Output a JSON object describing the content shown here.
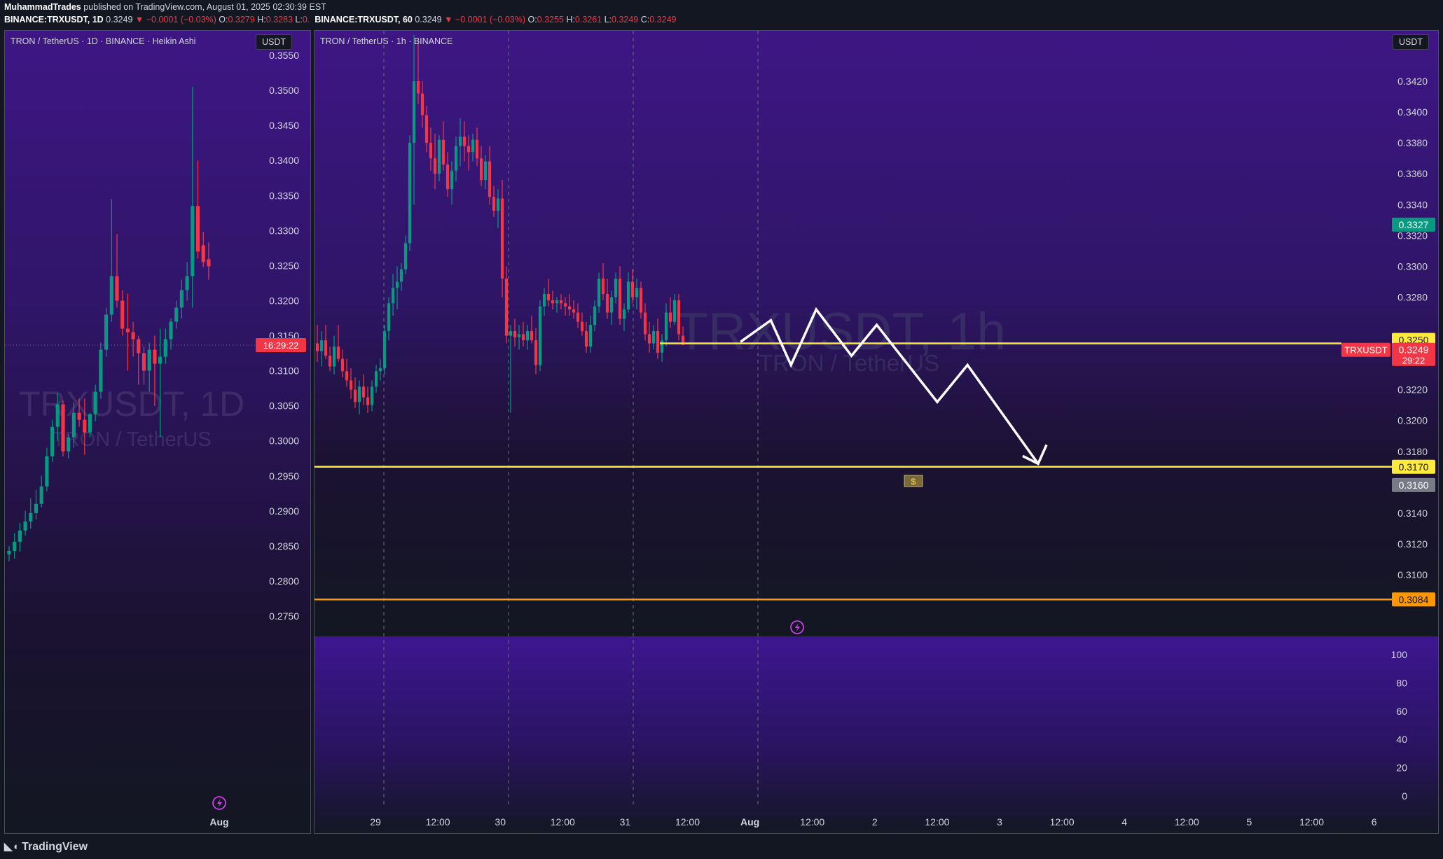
{
  "header": {
    "author": "MuhammadTrades",
    "published": "published on TradingView.com, August 01, 2025 02:30:39 EST",
    "left_ticker": "BINANCE:TRXUSDT, 1D",
    "left_price": "0.3249",
    "left_change": "−0.0001 (−0.03%)",
    "left_o": "0.3279",
    "left_h": "0.3283",
    "left_l": "0.",
    "right_ticker": "BINANCE:TRXUSDT, 60",
    "right_price": "0.3249",
    "right_change": "−0.0001 (−0.03%)",
    "right_o": "0.3255",
    "right_h": "0.3261",
    "right_l": "0.3249",
    "right_c": "0.3249"
  },
  "footer": {
    "brand": "TradingView"
  },
  "left_panel": {
    "title": "TRON / TetherUS · 1D · BINANCE · Heikin Ashi",
    "currency": "USDT",
    "watermark_symbol": "TRXUSDT, 1D",
    "watermark_name": "TRON / TetherUS",
    "countdown": "16:29:22",
    "x_label": "Aug"
  },
  "right_panel": {
    "title": "TRON / TetherUS · 1h · BINANCE",
    "currency": "USDT",
    "watermark_symbol": "TRXUSDT, 1h",
    "watermark_name": "TRON / TetherUS",
    "symbol_tag": "TRXUSDT",
    "price_tag": "0.3249",
    "price_countdown": "29:22",
    "high_tag": "0.3327",
    "level_tags": [
      "0.3250",
      "0.3170",
      "0.3160",
      "0.3084"
    ],
    "target_icon": "money-bag-icon"
  },
  "colors": {
    "up": "#089981",
    "down": "#f23645",
    "bg": "#131722",
    "purple_top": "#3e1685",
    "yellow": "#ffeb3b",
    "orange": "#ff9800",
    "grey_tag": "#787b86"
  },
  "chart_data": [
    {
      "type": "candlestick",
      "title": "TRON / TetherUS · 1D · BINANCE · Heikin Ashi",
      "ylim": [
        0.275,
        0.3575
      ],
      "y_ticks": [
        "0.3550",
        "0.3500",
        "0.3450",
        "0.3400",
        "0.3350",
        "0.3300",
        "0.3250",
        "0.3200",
        "0.3150",
        "0.3100",
        "0.3050",
        "0.3000",
        "0.2950",
        "0.2900",
        "0.2850",
        "0.2800",
        "0.2750"
      ],
      "x_ticks": [
        "Aug"
      ],
      "candles_ohlc": [
        [
          0.2838,
          0.285,
          0.2828,
          0.2843
        ],
        [
          0.2843,
          0.2868,
          0.2832,
          0.2856
        ],
        [
          0.2856,
          0.2883,
          0.2842,
          0.2872
        ],
        [
          0.2872,
          0.29,
          0.2865,
          0.2885
        ],
        [
          0.2885,
          0.2918,
          0.2875,
          0.2897
        ],
        [
          0.2897,
          0.293,
          0.2888,
          0.291
        ],
        [
          0.291,
          0.295,
          0.2905,
          0.2935
        ],
        [
          0.2935,
          0.299,
          0.2928,
          0.2978
        ],
        [
          0.2978,
          0.303,
          0.297,
          0.302
        ],
        [
          0.302,
          0.3068,
          0.3,
          0.3052
        ],
        [
          0.3052,
          0.3058,
          0.2978,
          0.2985
        ],
        [
          0.2985,
          0.301,
          0.2975,
          0.3005
        ],
        [
          0.3005,
          0.3055,
          0.299,
          0.304
        ],
        [
          0.304,
          0.306,
          0.302,
          0.303
        ],
        [
          0.303,
          0.306,
          0.298,
          0.3012
        ],
        [
          0.3012,
          0.304,
          0.3005,
          0.3038
        ],
        [
          0.3038,
          0.308,
          0.3028,
          0.307
        ],
        [
          0.307,
          0.314,
          0.306,
          0.313
        ],
        [
          0.313,
          0.319,
          0.312,
          0.318
        ],
        [
          0.318,
          0.3345,
          0.317,
          0.3235
        ],
        [
          0.3235,
          0.3295,
          0.319,
          0.32
        ],
        [
          0.32,
          0.3215,
          0.315,
          0.316
        ],
        [
          0.316,
          0.321,
          0.31,
          0.3155
        ],
        [
          0.3155,
          0.317,
          0.312,
          0.3145
        ],
        [
          0.3145,
          0.315,
          0.308,
          0.3125
        ],
        [
          0.3125,
          0.3135,
          0.308,
          0.31
        ],
        [
          0.31,
          0.314,
          0.307,
          0.313
        ],
        [
          0.313,
          0.315,
          0.305,
          0.311
        ],
        [
          0.311,
          0.316,
          0.3005,
          0.312
        ],
        [
          0.312,
          0.316,
          0.311,
          0.3145
        ],
        [
          0.3145,
          0.3175,
          0.313,
          0.317
        ],
        [
          0.317,
          0.32,
          0.316,
          0.319
        ],
        [
          0.319,
          0.323,
          0.3175,
          0.3215
        ],
        [
          0.3215,
          0.3255,
          0.32,
          0.3235
        ],
        [
          0.3235,
          0.3505,
          0.319,
          0.3335
        ],
        [
          0.3335,
          0.34,
          0.326,
          0.327
        ],
        [
          0.3279,
          0.3298,
          0.3248,
          0.3255
        ],
        [
          0.3259,
          0.3283,
          0.323,
          0.3249
        ]
      ]
    },
    {
      "type": "candlestick",
      "title": "TRON / TetherUS · 1h · BINANCE",
      "ylim": [
        0.3066,
        0.3457
      ],
      "y_ticks": [
        "0.3420",
        "0.3400",
        "0.3380",
        "0.3360",
        "0.3340",
        "0.3320",
        "0.3300",
        "0.3280",
        "0.3220",
        "0.3200",
        "0.3180",
        "0.3140",
        "0.3120",
        "0.3100"
      ],
      "x_ticks": [
        "29",
        "12:00",
        "30",
        "12:00",
        "31",
        "12:00",
        "Aug",
        "12:00",
        "2",
        "12:00",
        "3",
        "12:00",
        "4",
        "12:00",
        "5",
        "12:00",
        "6"
      ],
      "horizontal_levels": [
        {
          "price": 0.325,
          "color": "yellow"
        },
        {
          "price": 0.317,
          "color": "yellow"
        },
        {
          "price": 0.3084,
          "color": "orange"
        }
      ],
      "projection_path": [
        [
          1.6,
          0.3251
        ],
        [
          2.2,
          0.3265
        ],
        [
          2.6,
          0.3236
        ],
        [
          3.1,
          0.3272
        ],
        [
          3.8,
          0.3242
        ],
        [
          4.3,
          0.3262
        ],
        [
          5.5,
          0.3212
        ],
        [
          6.1,
          0.3236
        ],
        [
          7.5,
          0.3172
        ]
      ],
      "oscillator": {
        "ylim": [
          0,
          100
        ],
        "y_ticks": [
          "100",
          "80",
          "60",
          "40",
          "20",
          "0"
        ]
      },
      "candles_ohlc": [
        [
          0.325,
          0.3262,
          0.3238,
          0.3245
        ],
        [
          0.3245,
          0.3258,
          0.3235,
          0.3252
        ],
        [
          0.3252,
          0.3262,
          0.324,
          0.3242
        ],
        [
          0.3242,
          0.3248,
          0.3232,
          0.3235
        ],
        [
          0.3235,
          0.3255,
          0.323,
          0.3248
        ],
        [
          0.3248,
          0.3262,
          0.3238,
          0.324
        ],
        [
          0.324,
          0.3246,
          0.3228,
          0.3232
        ],
        [
          0.3232,
          0.324,
          0.3222,
          0.3226
        ],
        [
          0.3226,
          0.3234,
          0.3214,
          0.322
        ],
        [
          0.322,
          0.3228,
          0.3208,
          0.3212
        ],
        [
          0.3212,
          0.3226,
          0.3204,
          0.3222
        ],
        [
          0.3222,
          0.323,
          0.321,
          0.3215
        ],
        [
          0.3215,
          0.3222,
          0.3205,
          0.321
        ],
        [
          0.321,
          0.3226,
          0.3206,
          0.3222
        ],
        [
          0.3222,
          0.3236,
          0.3218,
          0.3232
        ],
        [
          0.3232,
          0.324,
          0.3226,
          0.3234
        ],
        [
          0.3234,
          0.3262,
          0.323,
          0.3258
        ],
        [
          0.3258,
          0.328,
          0.3252,
          0.3276
        ],
        [
          0.3276,
          0.3295,
          0.3268,
          0.3286
        ],
        [
          0.3286,
          0.33,
          0.3272,
          0.329
        ],
        [
          0.329,
          0.3302,
          0.3284,
          0.3298
        ],
        [
          0.3298,
          0.332,
          0.3295,
          0.3315
        ],
        [
          0.3315,
          0.3385,
          0.331,
          0.338
        ],
        [
          0.338,
          0.345,
          0.334,
          0.342
        ],
        [
          0.342,
          0.3445,
          0.3405,
          0.3412
        ],
        [
          0.3412,
          0.342,
          0.339,
          0.3398
        ],
        [
          0.3398,
          0.3404,
          0.3374,
          0.338
        ],
        [
          0.338,
          0.339,
          0.3362,
          0.337
        ],
        [
          0.337,
          0.3386,
          0.335,
          0.336
        ],
        [
          0.336,
          0.3385,
          0.3355,
          0.3382
        ],
        [
          0.3382,
          0.3394,
          0.3362,
          0.3366
        ],
        [
          0.3366,
          0.3374,
          0.3345,
          0.335
        ],
        [
          0.335,
          0.3368,
          0.334,
          0.3362
        ],
        [
          0.3362,
          0.3384,
          0.3355,
          0.3378
        ],
        [
          0.3378,
          0.3396,
          0.3365,
          0.3384
        ],
        [
          0.3384,
          0.3394,
          0.3368,
          0.3378
        ],
        [
          0.3378,
          0.3385,
          0.3362,
          0.3374
        ],
        [
          0.3374,
          0.3386,
          0.3368,
          0.3382
        ],
        [
          0.3382,
          0.339,
          0.3365,
          0.337
        ],
        [
          0.337,
          0.3378,
          0.3352,
          0.3356
        ],
        [
          0.3356,
          0.3372,
          0.335,
          0.3368
        ],
        [
          0.3368,
          0.3378,
          0.334,
          0.3345
        ],
        [
          0.3345,
          0.3352,
          0.3332,
          0.3336
        ],
        [
          0.3336,
          0.335,
          0.3325,
          0.3344
        ],
        [
          0.3344,
          0.3356,
          0.328,
          0.3292
        ],
        [
          0.3292,
          0.33,
          0.325,
          0.3255
        ],
        [
          0.3255,
          0.3262,
          0.3205,
          0.3258
        ],
        [
          0.3258,
          0.3266,
          0.3248,
          0.3254
        ],
        [
          0.3254,
          0.3262,
          0.3246,
          0.3256
        ],
        [
          0.3256,
          0.3264,
          0.3248,
          0.3252
        ],
        [
          0.3252,
          0.3262,
          0.3246,
          0.3258
        ],
        [
          0.3258,
          0.3268,
          0.325,
          0.3252
        ],
        [
          0.3252,
          0.326,
          0.323,
          0.3236
        ],
        [
          0.3236,
          0.3278,
          0.3232,
          0.3274
        ],
        [
          0.3274,
          0.3286,
          0.3268,
          0.3282
        ],
        [
          0.3282,
          0.3292,
          0.3274,
          0.3278
        ],
        [
          0.3278,
          0.3284,
          0.3272,
          0.3276
        ],
        [
          0.3276,
          0.328,
          0.327,
          0.3278
        ],
        [
          0.3278,
          0.3282,
          0.3272,
          0.3276
        ],
        [
          0.3276,
          0.328,
          0.3268,
          0.3274
        ],
        [
          0.3274,
          0.3282,
          0.3268,
          0.3272
        ],
        [
          0.3272,
          0.3278,
          0.3266,
          0.327
        ],
        [
          0.327,
          0.3276,
          0.326,
          0.3264
        ],
        [
          0.3264,
          0.327,
          0.3255,
          0.3258
        ],
        [
          0.3258,
          0.3264,
          0.3244,
          0.3248
        ],
        [
          0.3248,
          0.3268,
          0.3244,
          0.3262
        ],
        [
          0.3262,
          0.3278,
          0.3258,
          0.3274
        ],
        [
          0.3274,
          0.3296,
          0.327,
          0.3292
        ],
        [
          0.3292,
          0.3302,
          0.3278,
          0.3282
        ],
        [
          0.3282,
          0.3292,
          0.3266,
          0.327
        ],
        [
          0.327,
          0.3284,
          0.3262,
          0.328
        ],
        [
          0.328,
          0.3296,
          0.3276,
          0.3292
        ],
        [
          0.3292,
          0.33,
          0.3262,
          0.3266
        ],
        [
          0.3266,
          0.3276,
          0.3258,
          0.3272
        ],
        [
          0.3272,
          0.3296,
          0.327,
          0.329
        ],
        [
          0.329,
          0.3298,
          0.3276,
          0.328
        ],
        [
          0.328,
          0.3292,
          0.3272,
          0.3286
        ],
        [
          0.3286,
          0.329,
          0.3266,
          0.327
        ],
        [
          0.327,
          0.3276,
          0.3252,
          0.3256
        ],
        [
          0.3256,
          0.3264,
          0.3244,
          0.325
        ],
        [
          0.325,
          0.3262,
          0.3246,
          0.3258
        ],
        [
          0.3258,
          0.3266,
          0.324,
          0.3244
        ],
        [
          0.3244,
          0.3256,
          0.3238,
          0.3252
        ],
        [
          0.3252,
          0.3276,
          0.3248,
          0.327
        ],
        [
          0.327,
          0.328,
          0.326,
          0.3264
        ],
        [
          0.3264,
          0.3282,
          0.3262,
          0.3278
        ],
        [
          0.3278,
          0.3282,
          0.3252,
          0.3256
        ],
        [
          0.3255,
          0.3261,
          0.3249,
          0.3249
        ]
      ]
    }
  ]
}
